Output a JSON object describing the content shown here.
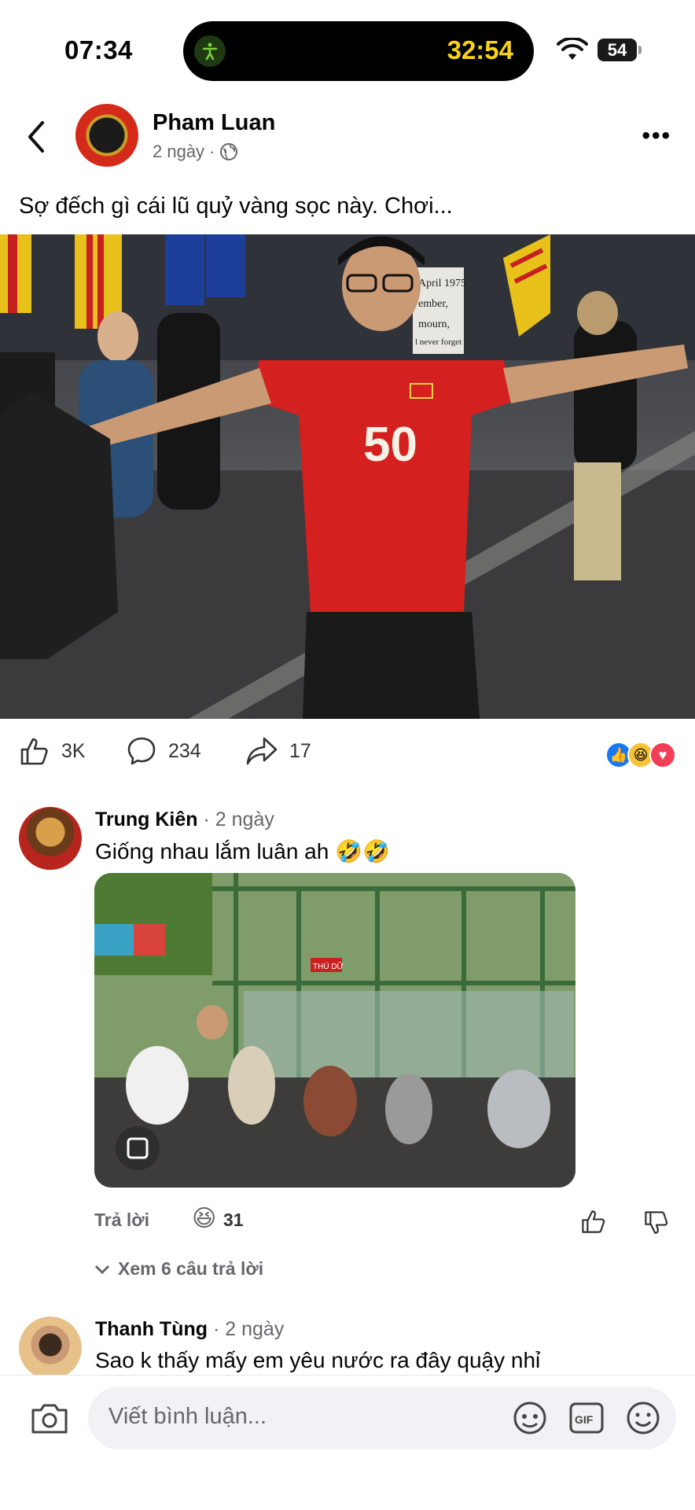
{
  "status_bar": {
    "time": "07:34",
    "timer": "32:54",
    "battery": "54"
  },
  "post": {
    "author": "Pham Luan",
    "time": "2 ngày",
    "separator": "·",
    "text": "Sợ đếch gì cái lũ quỷ vàng sọc này. Chơi...",
    "photo_text": {
      "jersey_number": "50",
      "sign_lines": [
        "April 1975",
        "ember,",
        "mourn,",
        "l never forget"
      ]
    },
    "likes": "3K",
    "comments": "234",
    "shares": "17"
  },
  "comments": [
    {
      "name": "Trung Kiên",
      "time": "· 2 ngày",
      "text": "Giống nhau lắm luân ah 🤣🤣",
      "image_sign": "THÚ DỮ",
      "reply_label": "Trả lời",
      "reaction_count": "31"
    },
    {
      "name": "Thanh Tùng",
      "time": "· 2 ngày",
      "text": "Sao k thấy mấy em yêu nước ra đây quậy nhỉ"
    }
  ],
  "view_replies": "Xem 6 câu trả lời",
  "composer": {
    "placeholder": "Viết bình luận..."
  },
  "icons": [
    "back-arrow-icon",
    "globe-icon",
    "more-icon",
    "like-icon",
    "comment-icon",
    "share-icon",
    "camera-icon",
    "avatar-sticker-icon",
    "gif-icon",
    "emoji-icon"
  ],
  "colors": {
    "like_blue": "#1877f2",
    "love_red": "#f33e58",
    "timer_yellow": "#f5d21b"
  }
}
